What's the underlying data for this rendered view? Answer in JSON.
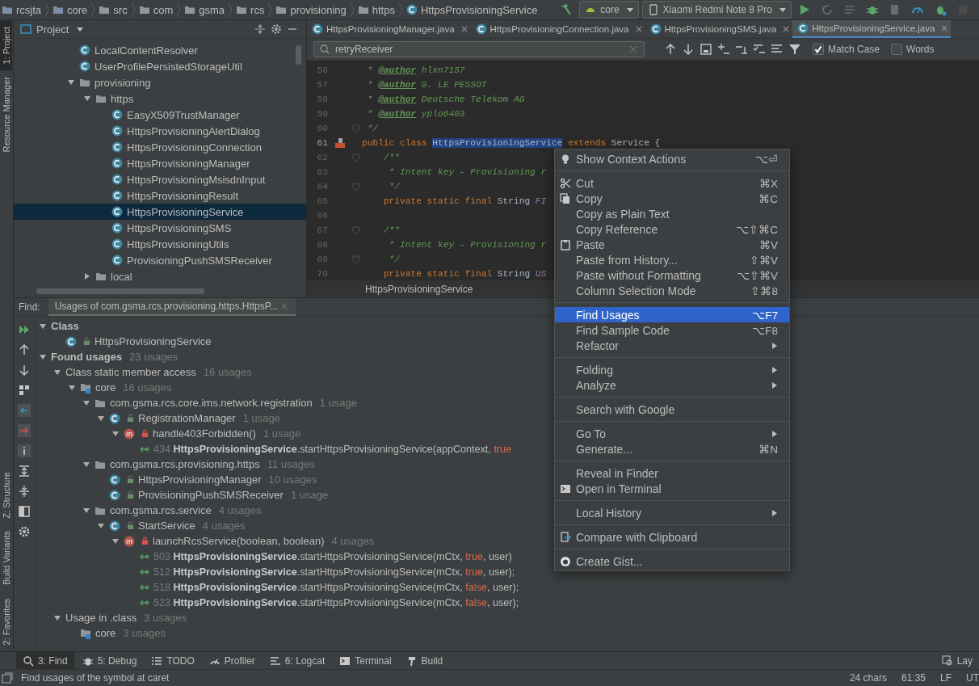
{
  "navbar": {
    "breadcrumbs": [
      {
        "label": "rcsjta",
        "kind": "project"
      },
      {
        "label": "core",
        "kind": "module"
      },
      {
        "label": "src",
        "kind": "folder"
      },
      {
        "label": "com",
        "kind": "folder"
      },
      {
        "label": "gsma",
        "kind": "folder"
      },
      {
        "label": "rcs",
        "kind": "folder"
      },
      {
        "label": "provisioning",
        "kind": "folder"
      },
      {
        "label": "https",
        "kind": "folder"
      },
      {
        "label": "HttpsProvisioningService",
        "kind": "class"
      }
    ],
    "run_config": "core",
    "device": "Xiaomi Redmi Note 8 Pro"
  },
  "side_strip": {
    "top": [
      {
        "label": "1: Project",
        "selected": true
      },
      {
        "label": "Resource Manager",
        "selected": false
      }
    ],
    "bottom": [
      {
        "label": "Z: Structure",
        "selected": false
      },
      {
        "label": "Build Variants",
        "selected": false
      },
      {
        "label": "2: Favorites",
        "selected": false
      }
    ]
  },
  "project": {
    "title": "Project",
    "tree": [
      {
        "kind": "class",
        "label": "LocalContentResolver",
        "selected": false
      },
      {
        "kind": "class",
        "label": "UserProfilePersistedStorageUtil",
        "selected": false
      },
      {
        "kind": "folder",
        "label": "provisioning",
        "expanded": true,
        "selected": false,
        "children": [
          {
            "kind": "folder",
            "label": "https",
            "expanded": true,
            "selected": false,
            "children": [
              {
                "kind": "class",
                "label": "EasyX509TrustManager",
                "selected": false
              },
              {
                "kind": "class",
                "label": "HttpsProvisioningAlertDialog",
                "selected": false
              },
              {
                "kind": "class",
                "label": "HttpsProvisioningConnection",
                "selected": false
              },
              {
                "kind": "class",
                "label": "HttpsProvisioningManager",
                "selected": false
              },
              {
                "kind": "class",
                "label": "HttpsProvisioningMsisdnInput",
                "selected": false
              },
              {
                "kind": "class",
                "label": "HttpsProvisioningResult",
                "selected": false
              },
              {
                "kind": "class",
                "label": "HttpsProvisioningService",
                "selected": true
              },
              {
                "kind": "class",
                "label": "HttpsProvisioningSMS",
                "selected": false
              },
              {
                "kind": "class",
                "label": "HttpsProvisioningUtils",
                "selected": false
              },
              {
                "kind": "class",
                "label": "ProvisioningPushSMSReceiver",
                "selected": false
              }
            ]
          },
          {
            "kind": "folder",
            "label": "local",
            "expanded": false,
            "selected": false
          }
        ]
      }
    ]
  },
  "editor": {
    "tabs": [
      {
        "label": "HttpsProvisioningManager.java",
        "selected": false
      },
      {
        "label": "HttpsProvisioningConnection.java",
        "selected": false
      },
      {
        "label": "HttpsProvisioningSMS.java",
        "selected": false
      },
      {
        "label": "HttpsProvisioningService.java",
        "selected": true
      }
    ],
    "search": {
      "value": "retryReceiver",
      "match_case": {
        "label": "Match Case",
        "checked": true
      },
      "words": {
        "label": "Words",
        "checked": false
      }
    },
    "lines": [
      {
        "number": "56",
        "current": false,
        "fold": false,
        "parts": [
          {
            "kind": "comment",
            "text": " * "
          },
          {
            "kind": "doctag",
            "text": "@author"
          },
          {
            "kind": "comment",
            "text": " hlxn7157"
          }
        ]
      },
      {
        "number": "57",
        "current": false,
        "fold": false,
        "parts": [
          {
            "kind": "comment",
            "text": " * "
          },
          {
            "kind": "doctag",
            "text": "@author"
          },
          {
            "kind": "comment",
            "text": " G. LE PESSOT"
          }
        ]
      },
      {
        "number": "58",
        "current": false,
        "fold": false,
        "parts": [
          {
            "kind": "comment",
            "text": " * "
          },
          {
            "kind": "doctag",
            "text": "@author"
          },
          {
            "kind": "comment",
            "text": " Deutsche Telekom AG"
          }
        ]
      },
      {
        "number": "59",
        "current": false,
        "fold": false,
        "parts": [
          {
            "kind": "comment",
            "text": " * "
          },
          {
            "kind": "doctag",
            "text": "@author"
          },
          {
            "kind": "comment",
            "text": " yplo6403"
          }
        ]
      },
      {
        "number": "60",
        "current": false,
        "fold": true,
        "parts": [
          {
            "kind": "comment",
            "text": " */"
          }
        ]
      },
      {
        "number": "61",
        "current": true,
        "fold": false,
        "parts": [
          {
            "kind": "keyword",
            "text": "public class "
          },
          {
            "kind": "selected",
            "text": "HttpsProvisioningService"
          },
          {
            "kind": "keyword",
            "text": " extends "
          },
          {
            "kind": "plain",
            "text": "Service {"
          }
        ]
      },
      {
        "number": "62",
        "current": false,
        "fold": true,
        "parts": [
          {
            "kind": "comment",
            "text": "    /**"
          }
        ]
      },
      {
        "number": "63",
        "current": false,
        "fold": false,
        "parts": [
          {
            "kind": "comment",
            "text": "     * Intent key - Provisioning r"
          }
        ]
      },
      {
        "number": "64",
        "current": false,
        "fold": true,
        "parts": [
          {
            "kind": "comment",
            "text": "     */"
          }
        ]
      },
      {
        "number": "65",
        "current": false,
        "fold": false,
        "parts": [
          {
            "kind": "keyword",
            "text": "    private static final "
          },
          {
            "kind": "plain",
            "text": "String "
          },
          {
            "kind": "const",
            "text": "FI"
          }
        ]
      },
      {
        "number": "66",
        "current": false,
        "fold": false
      },
      {
        "number": "67",
        "current": false,
        "fold": true,
        "parts": [
          {
            "kind": "comment",
            "text": "    /**"
          }
        ]
      },
      {
        "number": "68",
        "current": false,
        "fold": false,
        "parts": [
          {
            "kind": "comment",
            "text": "     * Intent key - Provisioning r"
          }
        ]
      },
      {
        "number": "69",
        "current": false,
        "fold": true,
        "parts": [
          {
            "kind": "comment",
            "text": "     */"
          }
        ]
      },
      {
        "number": "70",
        "current": false,
        "fold": false,
        "parts": [
          {
            "kind": "keyword",
            "text": "    private static final "
          },
          {
            "kind": "plain",
            "text": "String "
          },
          {
            "kind": "const",
            "text": "US"
          }
        ]
      }
    ],
    "breadcrumb": "HttpsProvisioningService"
  },
  "find": {
    "label": "Find:",
    "tab": "Usages of com.gsma.rcs.provisioning.https.HttpsP...",
    "tree": [
      {
        "kind": "group",
        "label": "Class",
        "expanded": true,
        "children": [
          {
            "kind": "class",
            "label": "HttpsProvisioningService"
          }
        ]
      },
      {
        "kind": "group",
        "label": "Found usages",
        "count": "23 usages",
        "expanded": true,
        "children": [
          {
            "kind": "category",
            "label": "Class static member access",
            "count": "16 usages",
            "expanded": true,
            "children": [
              {
                "kind": "module",
                "label": "core",
                "count": "16 usages",
                "expanded": true,
                "children": [
                  {
                    "kind": "package",
                    "label": "com.gsma.rcs.core.ims.network.registration",
                    "count": "1 usage",
                    "expanded": true,
                    "children": [
                      {
                        "kind": "class",
                        "label": "RegistrationManager",
                        "count": "1 usage",
                        "expanded": true,
                        "children": [
                          {
                            "kind": "method",
                            "label": "handle403Forbidden()",
                            "count": "1 usage",
                            "expanded": true,
                            "children": [
                              {
                                "kind": "usage",
                                "line": "434",
                                "parts": [
                                  {
                                    "kind": "target",
                                    "text": "HttpsProvisioningService"
                                  },
                                  {
                                    "kind": "plain",
                                    "text": ".startHttpsProvisioningService(appContext, "
                                  },
                                  {
                                    "kind": "literal",
                                    "text": "true"
                                  }
                                ]
                              }
                            ]
                          }
                        ]
                      }
                    ]
                  },
                  {
                    "kind": "package",
                    "label": "com.gsma.rcs.provisioning.https",
                    "count": "11 usages",
                    "expanded": true,
                    "children": [
                      {
                        "kind": "class",
                        "label": "HttpsProvisioningManager",
                        "count": "10 usages",
                        "expanded": false
                      },
                      {
                        "kind": "class",
                        "label": "ProvisioningPushSMSReceiver",
                        "count": "1 usage",
                        "expanded": false
                      }
                    ]
                  },
                  {
                    "kind": "package",
                    "label": "com.gsma.rcs.service",
                    "count": "4 usages",
                    "expanded": true,
                    "children": [
                      {
                        "kind": "class",
                        "label": "StartService",
                        "count": "4 usages",
                        "expanded": true,
                        "children": [
                          {
                            "kind": "method",
                            "label": "launchRcsService(boolean, boolean)",
                            "count": "4 usages",
                            "expanded": true,
                            "children": [
                              {
                                "kind": "usage",
                                "line": "503",
                                "parts": [
                                  {
                                    "kind": "target",
                                    "text": "HttpsProvisioningService"
                                  },
                                  {
                                    "kind": "plain",
                                    "text": ".startHttpsProvisioningService(mCtx, "
                                  },
                                  {
                                    "kind": "literal",
                                    "text": "true"
                                  },
                                  {
                                    "kind": "plain",
                                    "text": ", user)"
                                  }
                                ]
                              },
                              {
                                "kind": "usage",
                                "line": "512",
                                "parts": [
                                  {
                                    "kind": "target",
                                    "text": "HttpsProvisioningService"
                                  },
                                  {
                                    "kind": "plain",
                                    "text": ".startHttpsProvisioningService(mCtx, "
                                  },
                                  {
                                    "kind": "literal",
                                    "text": "true"
                                  },
                                  {
                                    "kind": "plain",
                                    "text": ", user);"
                                  }
                                ]
                              },
                              {
                                "kind": "usage",
                                "line": "518",
                                "parts": [
                                  {
                                    "kind": "target",
                                    "text": "HttpsProvisioningService"
                                  },
                                  {
                                    "kind": "plain",
                                    "text": ".startHttpsProvisioningService(mCtx, "
                                  },
                                  {
                                    "kind": "literal",
                                    "text": "false"
                                  },
                                  {
                                    "kind": "plain",
                                    "text": ", user);"
                                  }
                                ]
                              },
                              {
                                "kind": "usage",
                                "line": "523",
                                "parts": [
                                  {
                                    "kind": "target",
                                    "text": "HttpsProvisioningService"
                                  },
                                  {
                                    "kind": "plain",
                                    "text": ".startHttpsProvisioningService(mCtx, "
                                  },
                                  {
                                    "kind": "literal",
                                    "text": "false"
                                  },
                                  {
                                    "kind": "plain",
                                    "text": ", user);"
                                  }
                                ]
                              }
                            ]
                          }
                        ]
                      }
                    ]
                  }
                ]
              }
            ]
          },
          {
            "kind": "category",
            "label": "Usage in .class",
            "count": "3 usages",
            "expanded": true,
            "children": [
              {
                "kind": "module",
                "label": "core",
                "count": "3 usages",
                "expanded": true
              }
            ]
          }
        ]
      }
    ]
  },
  "context_menu": {
    "groups": [
      {
        "items": [
          {
            "label": "Show Context Actions",
            "shortcut": "⌥⏎",
            "submenu": false,
            "selected": false
          }
        ]
      },
      {
        "items": [
          {
            "label": "Cut",
            "shortcut": "⌘X",
            "submenu": false,
            "selected": false
          },
          {
            "label": "Copy",
            "shortcut": "⌘C",
            "submenu": false,
            "selected": false
          },
          {
            "label": "Copy as Plain Text",
            "submenu": false,
            "selected": false
          },
          {
            "label": "Copy Reference",
            "shortcut": "⌥⇧⌘C",
            "submenu": false,
            "selected": false
          },
          {
            "label": "Paste",
            "shortcut": "⌘V",
            "submenu": false,
            "selected": false
          },
          {
            "label": "Paste from History...",
            "shortcut": "⇧⌘V",
            "submenu": false,
            "selected": false
          },
          {
            "label": "Paste without Formatting",
            "shortcut": "⌥⇧⌘V",
            "submenu": false,
            "selected": false
          },
          {
            "label": "Column Selection Mode",
            "shortcut": "⇧⌘8",
            "submenu": false,
            "selected": false
          }
        ]
      },
      {
        "items": [
          {
            "label": "Find Usages",
            "shortcut": "⌥F7",
            "submenu": false,
            "selected": true
          },
          {
            "label": "Find Sample Code",
            "shortcut": "⌥F8",
            "submenu": false,
            "selected": false
          },
          {
            "label": "Refactor",
            "submenu": true,
            "selected": false
          }
        ]
      },
      {
        "items": [
          {
            "label": "Folding",
            "submenu": true,
            "selected": false
          },
          {
            "label": "Analyze",
            "submenu": true,
            "selected": false
          }
        ]
      },
      {
        "items": [
          {
            "label": "Search with Google",
            "submenu": false,
            "selected": false
          }
        ]
      },
      {
        "items": [
          {
            "label": "Go To",
            "submenu": true,
            "selected": false
          },
          {
            "label": "Generate...",
            "shortcut": "⌘N",
            "submenu": false,
            "selected": false
          }
        ]
      },
      {
        "items": [
          {
            "label": "Reveal in Finder",
            "submenu": false,
            "selected": false
          },
          {
            "label": "Open in Terminal",
            "submenu": false,
            "selected": false
          }
        ]
      },
      {
        "items": [
          {
            "label": "Local History",
            "submenu": true,
            "selected": false
          }
        ]
      },
      {
        "items": [
          {
            "label": "Compare with Clipboard",
            "submenu": false,
            "selected": false
          }
        ]
      },
      {
        "items": [
          {
            "label": "Create Gist...",
            "submenu": false,
            "selected": false
          }
        ]
      }
    ]
  },
  "tool_tabs": [
    {
      "label": "3: Find",
      "selected": true
    },
    {
      "label": "5: Debug",
      "selected": false
    },
    {
      "label": "TODO",
      "selected": false
    },
    {
      "label": "Profiler",
      "selected": false
    },
    {
      "label": "6: Logcat",
      "selected": false
    },
    {
      "label": "Terminal",
      "selected": false
    },
    {
      "label": "Build",
      "selected": false
    }
  ],
  "tool_tab_right": "Lay",
  "status_bar": {
    "message": "Find usages of the symbol at caret",
    "chars": "24 chars",
    "position": "61:35",
    "line_ending": "LF",
    "encoding": "UT"
  }
}
